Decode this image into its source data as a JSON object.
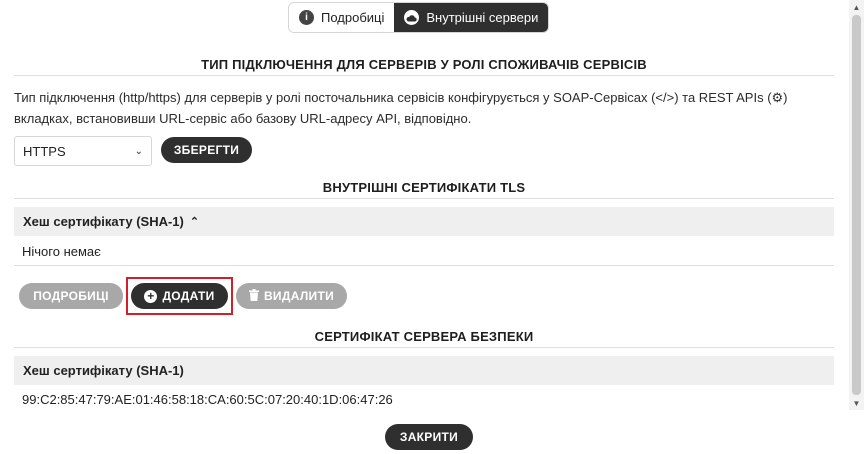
{
  "tabs": [
    {
      "label": "Подробиці",
      "icon": "info-icon",
      "active": false
    },
    {
      "label": "Внутрішні сервери",
      "icon": "cloud-icon",
      "active": true
    }
  ],
  "connection_type": {
    "title": "ТИП ПІДКЛЮЧЕННЯ ДЛЯ СЕРВЕРІВ У РОЛІ СПОЖИВАЧІВ СЕРВІСІВ",
    "description": "Тип підключення (http/https) для серверів у ролі посточальника сервісів конфігурується у SOAP-Сервісах (</>) та REST APIs (⚙) вкладках, встановивши URL-сервіс або базову URL-адресу API, відповідно.",
    "select_value": "HTTPS",
    "save_label": "ЗБЕРЕГТИ"
  },
  "tls_certs": {
    "title": "ВНУТРІШНІ СЕРТИФІКАТИ TLS",
    "column_header": "Хеш сертифікату (SHA-1)",
    "empty_text": "Нічого немає",
    "details_label": "ПОДРОБИЦІ",
    "add_label": "ДОДАТИ",
    "delete_label": "ВИДАЛИТИ"
  },
  "security_server_cert": {
    "title": "СЕРТИФІКАТ СЕРВЕРА БЕЗПЕКИ",
    "column_header": "Хеш сертифікату (SHA-1)",
    "hash": "99:C2:85:47:79:AE:01:46:58:18:CA:60:5C:07:20:40:1D:06:47:26"
  },
  "footer": {
    "close_label": "ЗАКРИТИ"
  },
  "colors": {
    "dark_button": "#2f2f2f",
    "disabled_button": "#a8a8a8",
    "highlight": "#d0202a",
    "table_header_bg": "#efefef"
  }
}
